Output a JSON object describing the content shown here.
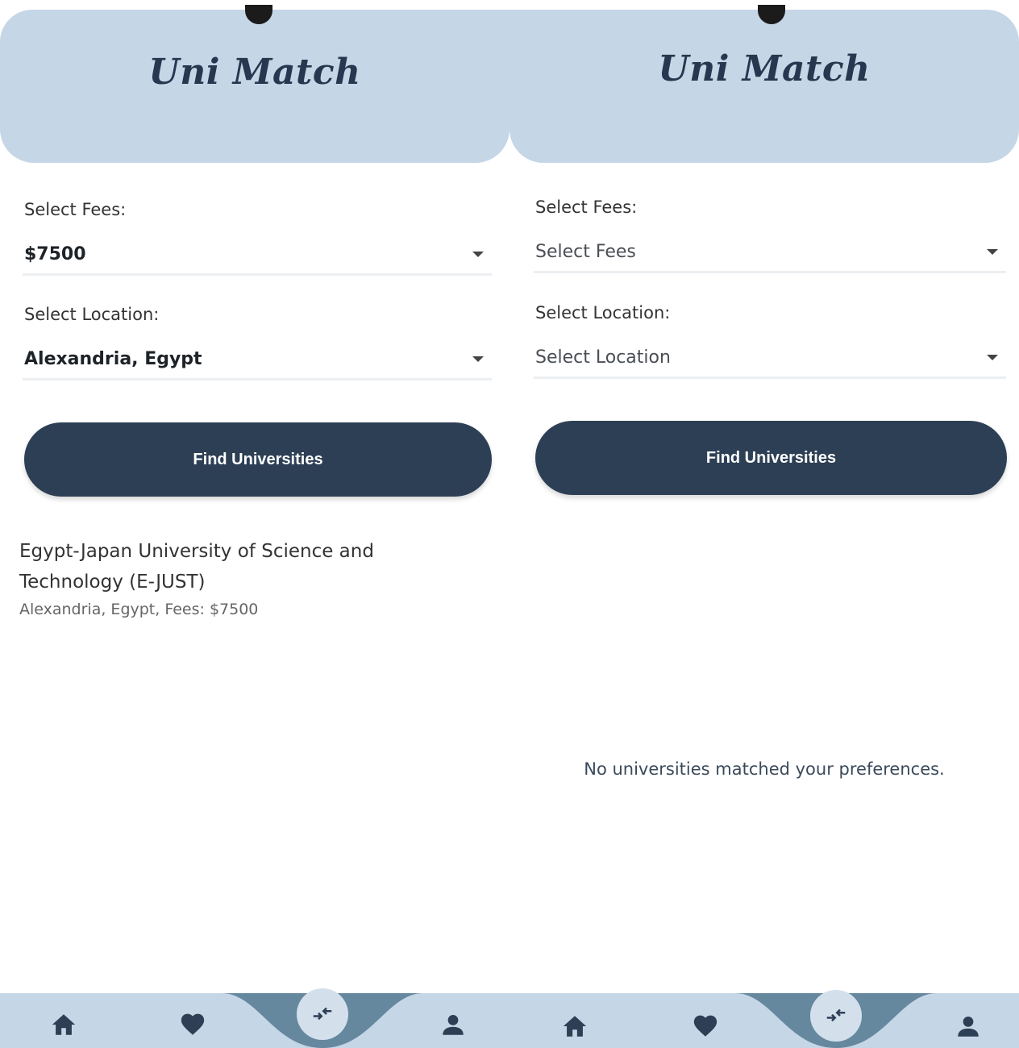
{
  "left": {
    "app_title": "Uni Match",
    "fees_label": "Select Fees:",
    "fees_value": "$7500",
    "location_label": "Select Location:",
    "location_value": "Alexandria, Egypt",
    "find_button": "Find Universities",
    "result": {
      "name": "Egypt-Japan University of Science and Technology (E-JUST)",
      "meta": "Alexandria, Egypt, Fees: $7500"
    }
  },
  "right": {
    "app_title": "Uni Match",
    "fees_label": "Select Fees:",
    "fees_placeholder": "Select Fees",
    "location_label": "Select Location:",
    "location_placeholder": "Select Location",
    "find_button": "Find Universities",
    "empty_message": "No universities matched your preferences."
  },
  "icons": [
    "home-icon",
    "heart-icon",
    "compare-icon",
    "person-icon"
  ],
  "colors": {
    "header_bg": "#c5d6e6",
    "title_text": "#26384f",
    "button_bg": "#2d3f55",
    "nav_bg": "#c5d6e6",
    "nav_curve": "#66889f",
    "nav_icon": "#2d3f55"
  }
}
